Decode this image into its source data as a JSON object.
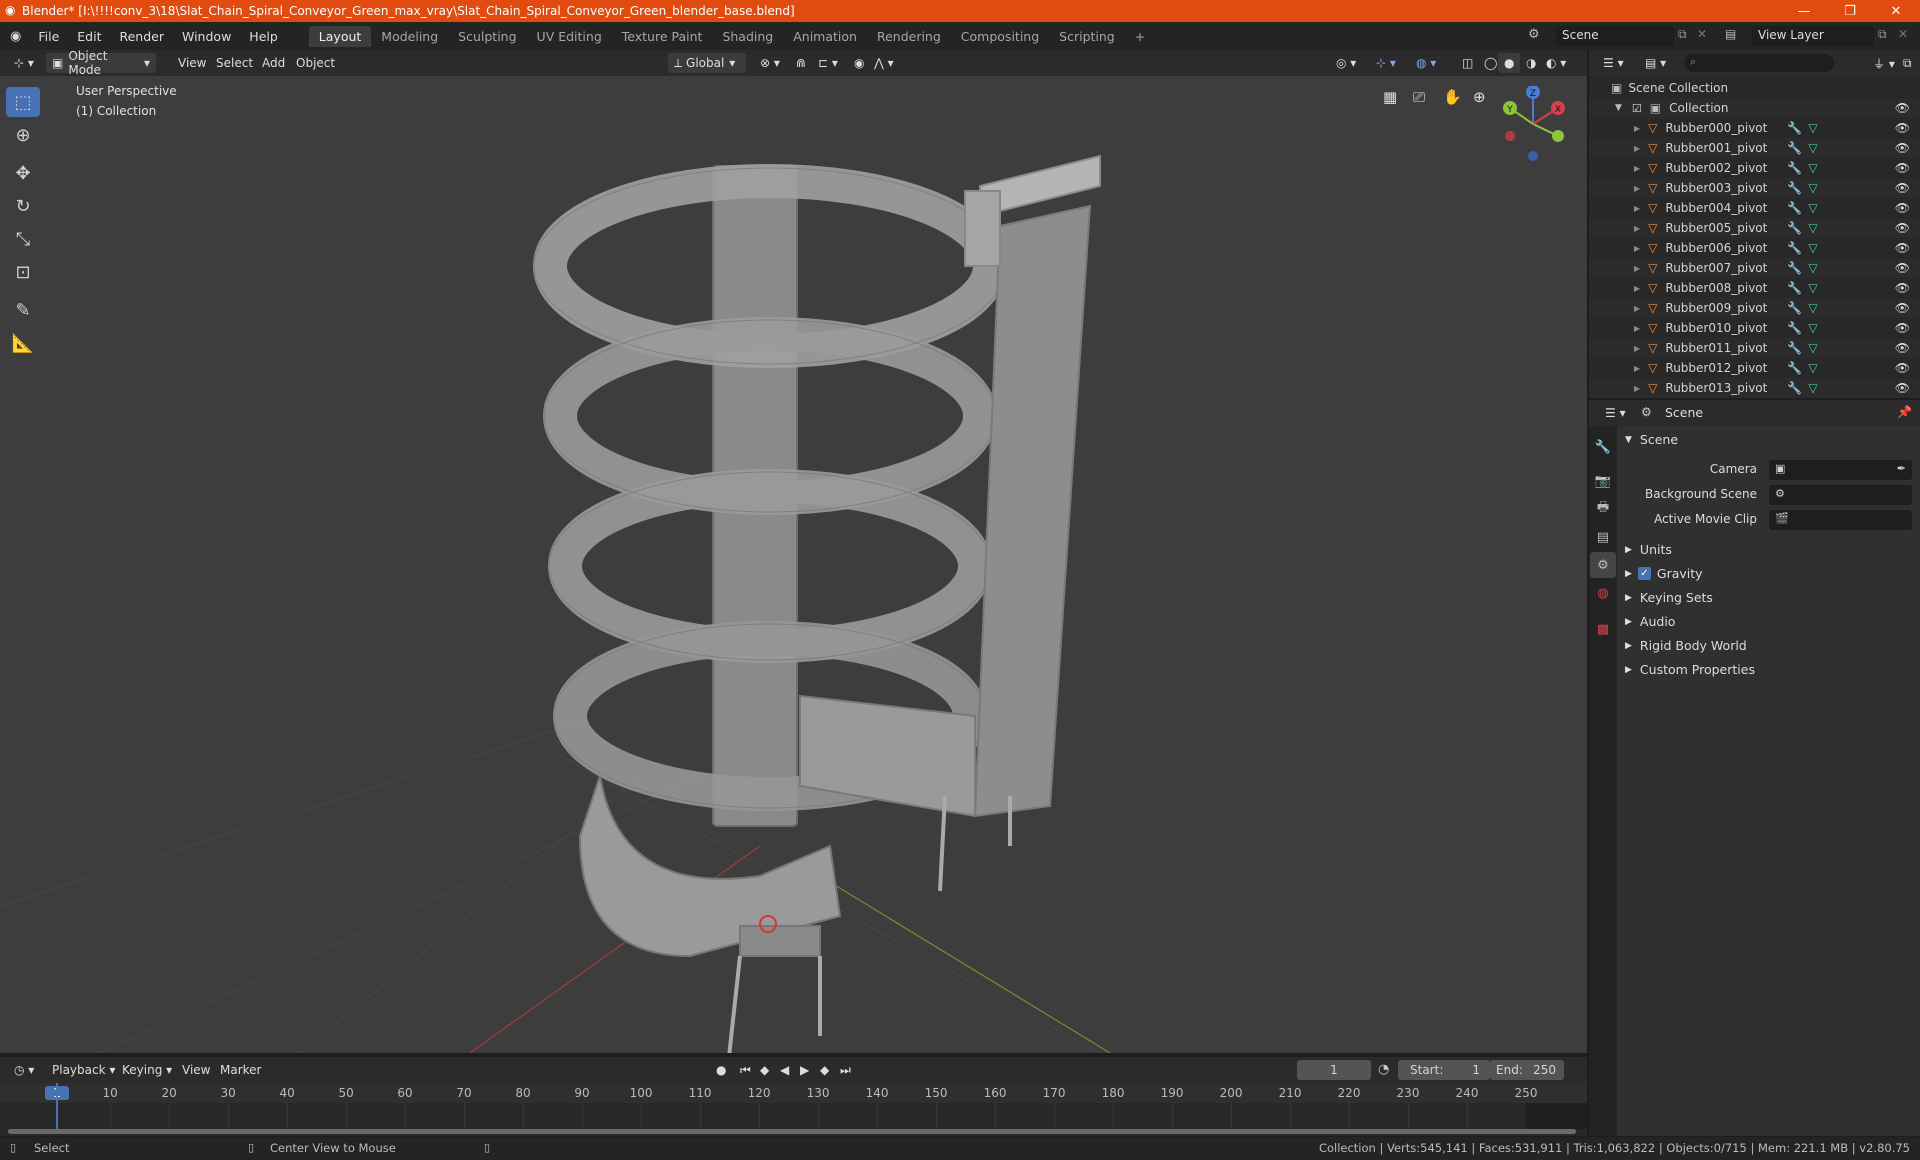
{
  "titlebar": {
    "title": "Blender* [I:\\!!!!conv_3\\18\\Slat_Chain_Spiral_Conveyor_Green_max_vray\\Slat_Chain_Spiral_Conveyor_Green_blender_base.blend]",
    "minimize": "—",
    "restore": "❐",
    "close": "✕"
  },
  "menu": [
    "File",
    "Edit",
    "Render",
    "Window",
    "Help"
  ],
  "workspaces": [
    "Layout",
    "Modeling",
    "Sculpting",
    "UV Editing",
    "Texture Paint",
    "Shading",
    "Animation",
    "Rendering",
    "Compositing",
    "Scripting"
  ],
  "workspace_add": "+",
  "scene_field": "Scene",
  "view_layer_field": "View Layer",
  "viewport_header": {
    "mode": "Object Mode",
    "view": "View",
    "select": "Select",
    "add": "Add",
    "object": "Object",
    "transform_orientation": "Global"
  },
  "viewport": {
    "perspective_label": "User Perspective",
    "collection_label": "(1) Collection",
    "gizmo": {
      "x": "X",
      "y": "Y",
      "z": "Z"
    }
  },
  "outliner": {
    "scene_collection": "Scene Collection",
    "collection": "Collection",
    "items": [
      "Rubber000_pivot",
      "Rubber001_pivot",
      "Rubber002_pivot",
      "Rubber003_pivot",
      "Rubber004_pivot",
      "Rubber005_pivot",
      "Rubber006_pivot",
      "Rubber007_pivot",
      "Rubber008_pivot",
      "Rubber009_pivot",
      "Rubber010_pivot",
      "Rubber011_pivot",
      "Rubber012_pivot",
      "Rubber013_pivot"
    ]
  },
  "properties": {
    "header": "Scene",
    "panel_title": "Scene",
    "camera_label": "Camera",
    "background_scene_label": "Background Scene",
    "active_movie_clip_label": "Active Movie Clip",
    "sections": [
      "Units",
      "Gravity",
      "Keying Sets",
      "Audio",
      "Rigid Body World",
      "Custom Properties"
    ]
  },
  "timeline": {
    "playback": "Playback",
    "keying": "Keying",
    "view": "View",
    "marker": "Marker",
    "current_frame": "1",
    "start_label": "Start:",
    "start_value": "1",
    "end_label": "End:",
    "end_value": "250",
    "ruler": [
      "1",
      "10",
      "20",
      "30",
      "40",
      "50",
      "60",
      "70",
      "80",
      "90",
      "100",
      "110",
      "120",
      "130",
      "140",
      "150",
      "160",
      "170",
      "180",
      "190",
      "200",
      "210",
      "220",
      "230",
      "240",
      "250"
    ]
  },
  "status": {
    "left": "Select",
    "middle": "Center View to Mouse",
    "right": "Collection | Verts:545,141 | Faces:531,911 | Tris:1,063,822 | Objects:0/715 | Mem: 221.1 MB | v2.80.75"
  },
  "colors": {
    "titlebar": "#e14b0f",
    "accent": "#4772b3",
    "mesh_icon": "#e8914a",
    "modifier_icon": "#6f9ee8",
    "data_icon": "#48c98a"
  }
}
